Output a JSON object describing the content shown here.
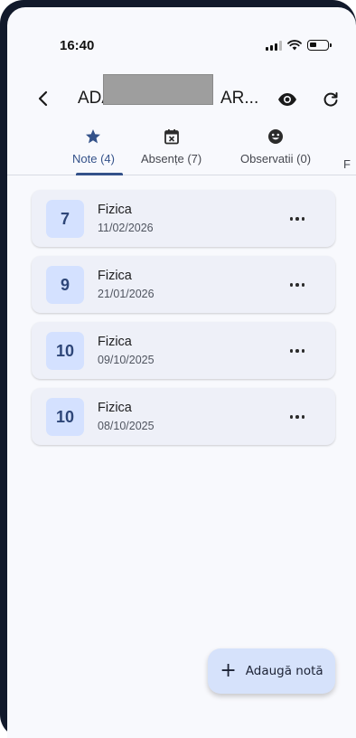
{
  "status_bar": {
    "time": "16:40",
    "icons": [
      "signal-icon",
      "wifi-icon",
      "battery-icon"
    ]
  },
  "app_bar": {
    "title_start": "ADA",
    "title_end": "AR...",
    "icons": [
      "back-arrow-icon",
      "eye-icon",
      "refresh-icon"
    ]
  },
  "tabs": [
    {
      "label": "Note (4)",
      "icon": "star-icon",
      "active": true
    },
    {
      "label": "Absențe (7)",
      "icon": "calendar-x-icon",
      "active": false
    },
    {
      "label": "Observatii (0)",
      "icon": "smiley-icon",
      "active": false
    },
    {
      "label": "F",
      "icon": "",
      "active": false
    }
  ],
  "grades": [
    {
      "value": "7",
      "subject": "Fizica",
      "date": "11/02/2026"
    },
    {
      "value": "9",
      "subject": "Fizica",
      "date": "21/01/2026"
    },
    {
      "value": "10",
      "subject": "Fizica",
      "date": "09/10/2025"
    },
    {
      "value": "10",
      "subject": "Fizica",
      "date": "08/10/2025"
    }
  ],
  "fab": {
    "label": "Adaugă notă",
    "icon": "plus-icon"
  },
  "colors": {
    "accent": "#34528a",
    "badge_bg": "#d4e1ff",
    "card_bg": "#eef0f8",
    "fab_bg": "#d6e2fb"
  }
}
